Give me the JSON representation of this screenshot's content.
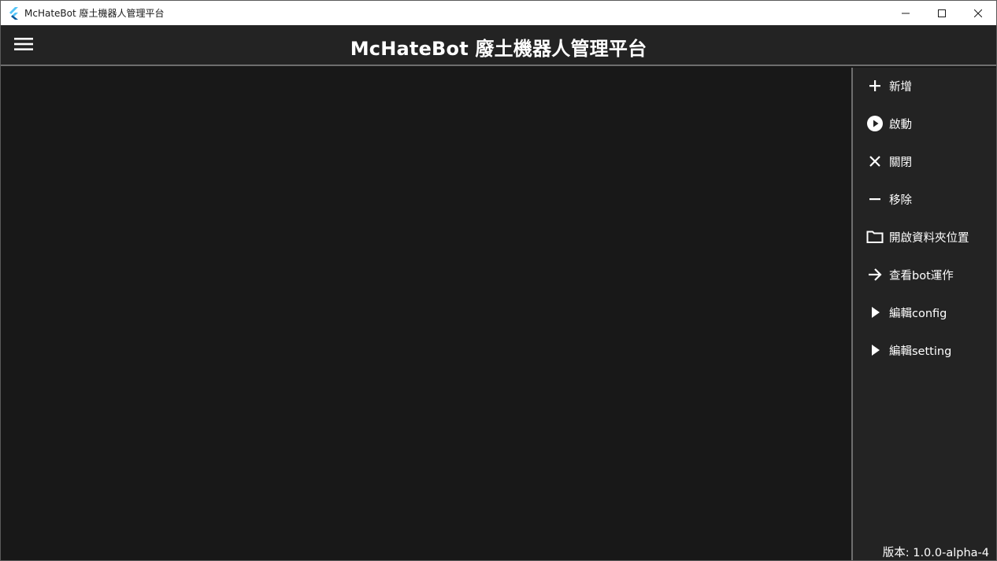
{
  "window": {
    "title": "McHateBot 廢土機器人管理平台",
    "controls": [
      "minimize-icon",
      "maximize-icon",
      "close-icon"
    ]
  },
  "appbar": {
    "title": "McHateBot 廢土機器人管理平台",
    "menu_icon": "hamburger-menu-icon"
  },
  "sidebar": {
    "items": [
      {
        "label": "新增",
        "icon": "plus-icon"
      },
      {
        "label": "啟動",
        "icon": "play-circle-icon"
      },
      {
        "label": "關閉",
        "icon": "close-x-icon"
      },
      {
        "label": "移除",
        "icon": "minus-icon"
      },
      {
        "label": "開啟資料夾位置",
        "icon": "folder-icon"
      },
      {
        "label": "查看bot運作",
        "icon": "arrow-right-icon"
      },
      {
        "label": "編輯config",
        "icon": "play-arrow-icon"
      },
      {
        "label": "編輯setting",
        "icon": "play-arrow-icon"
      }
    ],
    "version": "版本: 1.0.0-alpha-4"
  },
  "colors": {
    "background": "#181818",
    "surface": "#232323",
    "divider": "#6e6e6e",
    "text": "#ffffff",
    "titlebar": "#ffffff",
    "flutter_blue": "#42a5f5"
  }
}
